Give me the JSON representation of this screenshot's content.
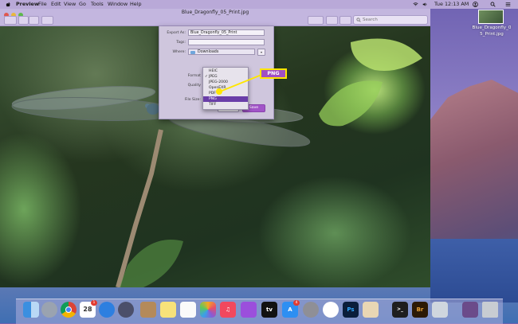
{
  "menubar": {
    "app_name": "Preview",
    "items": [
      "File",
      "Edit",
      "View",
      "Go",
      "Tools",
      "Window",
      "Help"
    ],
    "clock": "Tue 12:13 AM",
    "icons": [
      "apple-icon",
      "wifi-icon",
      "volume-icon",
      "user-icon",
      "search-icon",
      "list-icon"
    ]
  },
  "window": {
    "title": "Blue_Dragonfly_05_Print.jpg",
    "search_placeholder": "Search"
  },
  "export_sheet": {
    "export_as_label": "Export As:",
    "export_as_value": "Blue_Dragonfly_05_Print",
    "tags_label": "Tags:",
    "where_label": "Where:",
    "where_value": "Downloads",
    "format_label": "Format",
    "quality_label": "Quality",
    "file_size_label": "File Size:",
    "cancel_label": "Cancel",
    "save_label": "Save"
  },
  "format_menu": {
    "items": [
      "HEIC",
      "JPEG",
      "JPEG-2000",
      "OpenEXR",
      "PDF",
      "PNG",
      "TIFF"
    ],
    "checked": "JPEG",
    "highlighted": "PNG"
  },
  "callout": {
    "label": "PNG"
  },
  "desktop": {
    "file_label_line1": "Blue_Dragonfly_0",
    "file_label_line2": "5_Print.jpg"
  },
  "dock": {
    "apps": [
      "Finder",
      "Launchpad",
      "Chrome",
      "Calendar",
      "Safari",
      "Rocket",
      "Contacts",
      "Notes",
      "Reminders",
      "Photos",
      "Music",
      "Podcasts",
      "TV",
      "App Store",
      "Settings",
      "Slack",
      "Photoshop",
      "Preview",
      "Terminal",
      "Bridge",
      "Image Capture",
      "Documents",
      "Trash"
    ],
    "calendar_day": "28",
    "calendar_badge": "1",
    "app_store_badge": "4",
    "tv_label": "tv",
    "photoshop_label": "Ps",
    "bridge_label": "Br",
    "terminal_label": ">_"
  },
  "colors": {
    "accent": "#a04fc4",
    "callout_border": "#ffe600",
    "menu_highlight": "#6a3ea8"
  }
}
